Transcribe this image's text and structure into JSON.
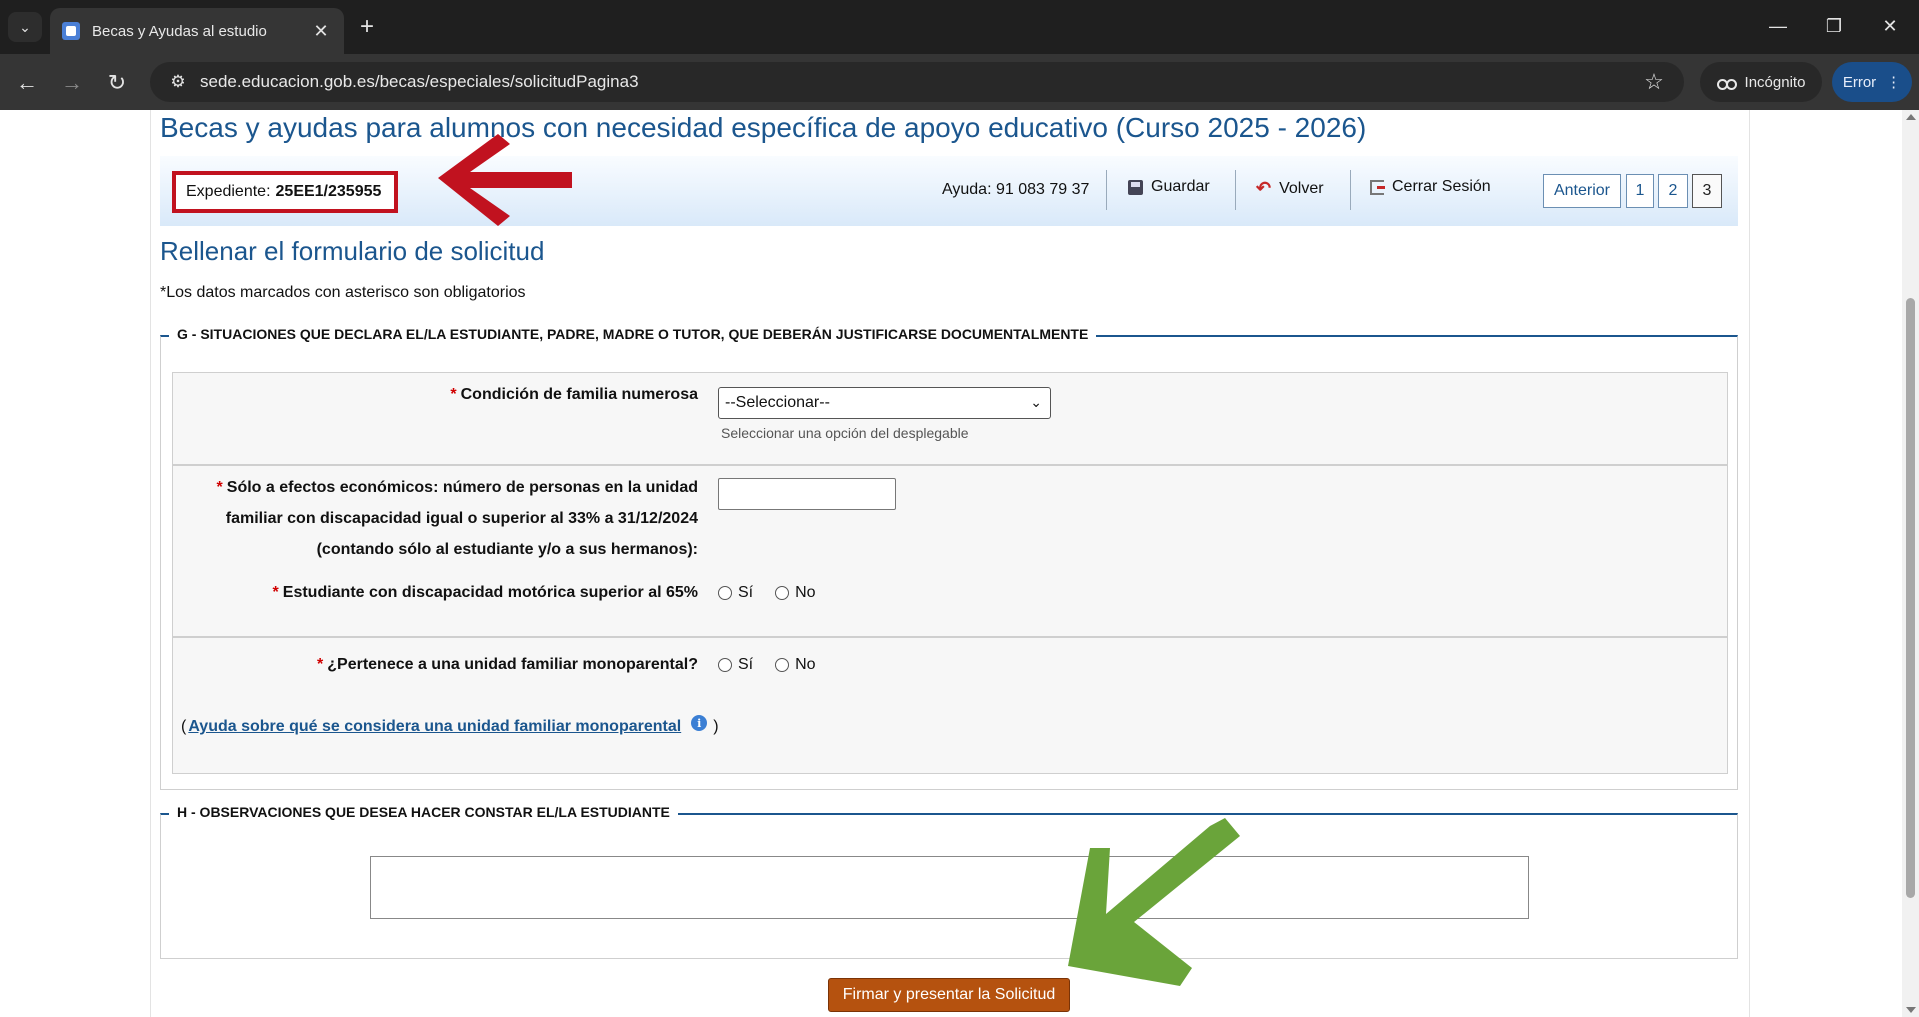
{
  "browser": {
    "tab_title": "Becas y Ayudas al estudio",
    "url": "sede.educacion.gob.es/becas/especiales/solicitudPagina3",
    "incognito_label": "Incógnito",
    "error_label": "Error"
  },
  "page": {
    "title": "Becas y ayudas para alumnos con necesidad específica de apoyo educativo (Curso 2025 - 2026)",
    "expediente_label": "Expediente:",
    "expediente_value": "25EE1/235955",
    "help_phone": "Ayuda: 91 083 79 37",
    "actions": {
      "save": "Guardar",
      "back": "Volver",
      "logout": "Cerrar Sesión"
    },
    "pager": {
      "previous": "Anterior",
      "pages": [
        "1",
        "2",
        "3"
      ],
      "current": "3"
    },
    "form_title": "Rellenar el formulario de solicitud",
    "required_note": "*Los datos marcados con asterisco son obligatorios"
  },
  "section_g": {
    "legend": "G - SITUACIONES QUE DECLARA EL/LA ESTUDIANTE, PADRE, MADRE O TUTOR, QUE DEBERÁN JUSTIFICARSE DOCUMENTALMENTE",
    "asterisk": "*",
    "familia_numerosa": {
      "label": "Condición de familia numerosa",
      "selected": "--Seleccionar--",
      "hint": "Seleccionar una opción del desplegable"
    },
    "discapacidad_personas": {
      "label_line1": "Sólo a efectos económicos: número de personas en la unidad",
      "label_line2": "familiar con discapacidad igual o superior al 33% a 31/12/2024",
      "label_line3": "(contando sólo al estudiante y/o a sus hermanos):",
      "value": ""
    },
    "discapacidad_motorica": {
      "label": "Estudiante con discapacidad motórica superior al 65%",
      "option_yes": "Sí",
      "option_no": "No"
    },
    "monoparental": {
      "label": "¿Pertenece a una unidad familiar monoparental?",
      "option_yes": "Sí",
      "option_no": "No",
      "help_open": "(",
      "help_link": "Ayuda sobre qué se considera una unidad familiar monoparental",
      "help_close": ")"
    }
  },
  "section_h": {
    "legend": "H - OBSERVACIONES QUE DESEA HACER CONSTAR EL/LA ESTUDIANTE",
    "observaciones_value": ""
  },
  "submit_label": "Firmar y presentar la Solicitud",
  "colors": {
    "brand_blue": "#1b568e",
    "highlight_red": "#c1121f",
    "arrow_green": "#6aa43a",
    "submit_orange": "#b5520f"
  }
}
